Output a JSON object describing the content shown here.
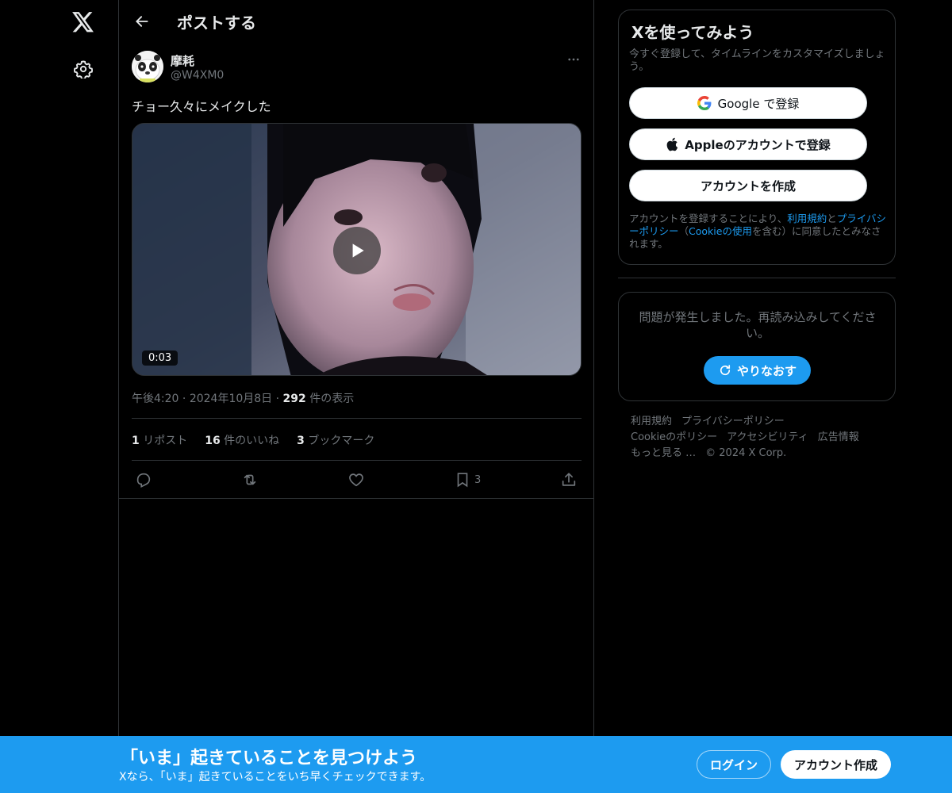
{
  "nav": {
    "logo_icon": "x-logo-icon",
    "settings_icon": "gear-icon"
  },
  "header": {
    "title": "ポストする",
    "back_icon": "arrow-left-icon"
  },
  "post": {
    "author_name": "摩耗",
    "author_handle": "@W4XM0",
    "text": "チョー久々にメイクした",
    "video_duration": "0:03",
    "time": "午後4:20",
    "date": "2024年10月8日",
    "views_count": "292",
    "views_label": "件の表示",
    "meta_sep": "·",
    "reposts_count": "1",
    "reposts_label": "リポスト",
    "likes_count": "16",
    "likes_label": "件のいいね",
    "bookmarks_count": "3",
    "bookmarks_label": "ブックマーク",
    "bookmark_action_count": "3"
  },
  "signup": {
    "title": "Xを使ってみよう",
    "subtitle": "今すぐ登録して、タイムラインをカスタマイズしましょう。",
    "google_button": "Google で登録",
    "apple_button": "Appleのアカウントで登録",
    "create_button": "アカウントを作成",
    "legal_prefix": "アカウントを登録することにより、",
    "legal_terms": "利用規約",
    "legal_and": "と",
    "legal_privacy": "プライバシーポリシー",
    "legal_paren_open": "（",
    "legal_cookie": "Cookieの使用",
    "legal_suffix": "を含む）に同意したとみなされます。"
  },
  "error": {
    "message": "問題が発生しました。再読み込みしてください。",
    "retry_button": "やりなおす"
  },
  "footer": {
    "links": [
      "利用規約",
      "プライバシーポリシー",
      "Cookieのポリシー",
      "アクセシビリティ",
      "広告情報",
      "もっと見る …"
    ],
    "copyright": "© 2024 X Corp."
  },
  "bottom_bar": {
    "title": "「いま」起きていることを見つけよう",
    "subtitle": "Xなら、「いま」起きていることをいち早くチェックできます。",
    "login_button": "ログイン",
    "create_button": "アカウント作成"
  },
  "colors": {
    "accent": "#1d9bf0",
    "background": "#000000",
    "border": "#2f3336",
    "muted_text": "#71767b"
  }
}
